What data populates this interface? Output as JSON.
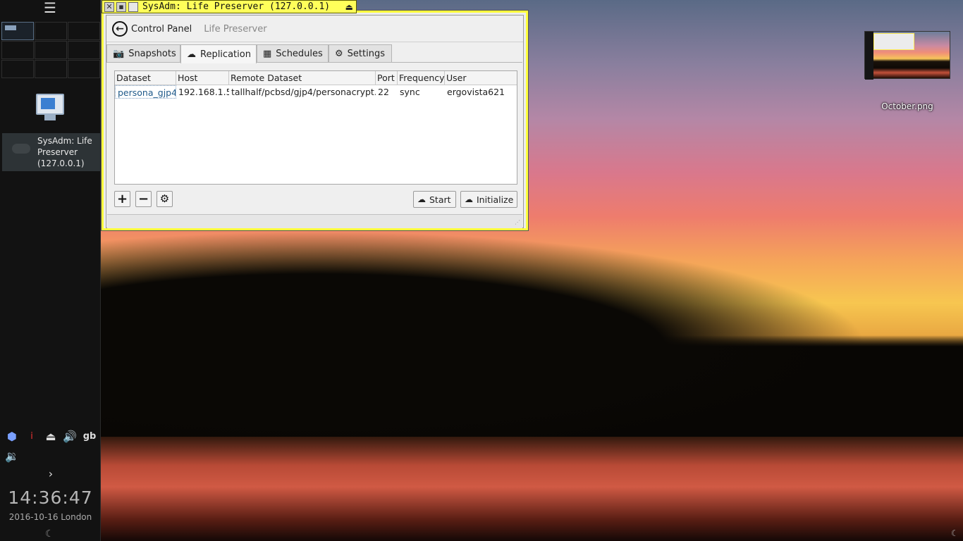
{
  "window": {
    "title": "SysAdm: Life Preserver (127.0.0.1)",
    "breadcrumb": {
      "back_label": "Control Panel",
      "current": "Life Preserver"
    },
    "tabs": [
      {
        "label": "Snapshots",
        "icon": "camera-icon"
      },
      {
        "label": "Replication",
        "icon": "cloud-upload-icon",
        "active": true
      },
      {
        "label": "Schedules",
        "icon": "calendar-icon"
      },
      {
        "label": "Settings",
        "icon": "gear-icon"
      }
    ],
    "table": {
      "columns": [
        "Dataset",
        "Host",
        "Remote Dataset",
        "Port",
        "Frequency",
        "User"
      ],
      "rows": [
        {
          "dataset": "persona_gjp4",
          "host": "192.168.1.5",
          "remote_dataset": "tallhalf/pcbsd/gjp4/personacrypt...",
          "port": "22",
          "frequency": "sync",
          "user": "ergovista621"
        }
      ]
    },
    "buttons": {
      "start": "Start",
      "initialize": "Initialize"
    }
  },
  "panel": {
    "taskbar_entry": "SysAdm: Life Preserver (127.0.0.1)",
    "keyboard_layout": "gb",
    "clock_time": "14:36:47",
    "clock_date": "2016-10-16 London"
  },
  "desktop": {
    "files": [
      {
        "name": "October.png"
      }
    ]
  },
  "colors": {
    "titlebar": "#ffff5a",
    "window_border": "#ffff3c",
    "panel_bg": "#121212"
  }
}
